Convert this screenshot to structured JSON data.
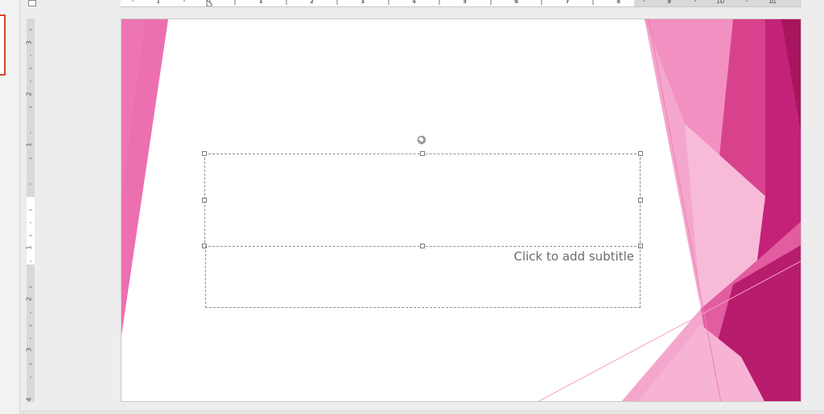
{
  "ruler": {
    "horizontal_labels": [
      "1",
      "1",
      "2",
      "3",
      "4",
      "5",
      "6",
      "7",
      "8",
      "9",
      "10",
      "11"
    ],
    "vertical_labels": [
      "3",
      "2",
      "1",
      "1",
      "2",
      "3",
      "4"
    ]
  },
  "slide": {
    "title_placeholder": "",
    "subtitle_placeholder": "Click to add subtitle"
  },
  "colors": {
    "accent": "#e0467f",
    "deep": "#b51a6b",
    "light": "#f4a3c8"
  }
}
